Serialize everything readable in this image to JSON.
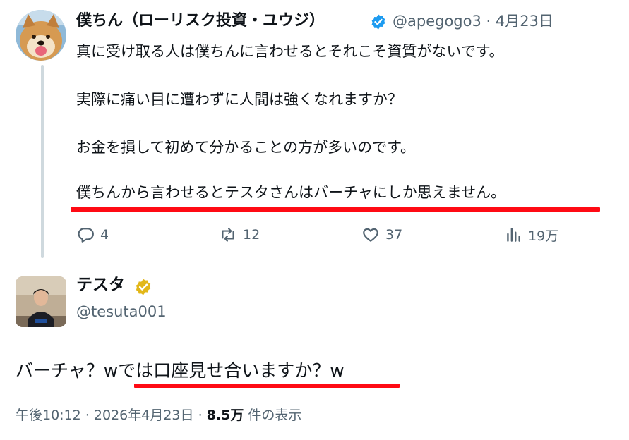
{
  "parent_tweet": {
    "author_name": "僕ちん（ローリスク投資・ユウジ）",
    "handle": "@apegogo3",
    "date_sep": "·",
    "date": "4月23日",
    "lines": [
      "真に受け取る人は僕ちんに言わせるとそれこそ資質がないです。",
      "実際に痛い目に遭わずに人間は強くなれますか？",
      "お金を損して初めて分かることの方が多いのです。",
      "僕ちんから言わせるとテスタさんはバーチャにしか思えません。"
    ],
    "stats": {
      "replies": "4",
      "retweets": "12",
      "likes": "37",
      "views": "19万"
    }
  },
  "reply_tweet": {
    "author_name": "テスタ",
    "handle": "@tesuta001",
    "text": "バーチャ？wでは口座見せ合いますか？w",
    "time": "午後10:12",
    "sep1": "·",
    "date": "2026年4月23日",
    "sep2": "·",
    "views_count": "8.5万",
    "views_label": "件の表示"
  },
  "colors": {
    "accent_blue": "#1d9bf0",
    "gold_badge": "#e2b719",
    "underline_red": "#ff0a14",
    "muted_text": "#536471"
  },
  "icons": [
    "reply-icon",
    "retweet-icon",
    "like-icon",
    "views-icon",
    "verified-badge-icon",
    "gold-verified-badge-icon"
  ]
}
